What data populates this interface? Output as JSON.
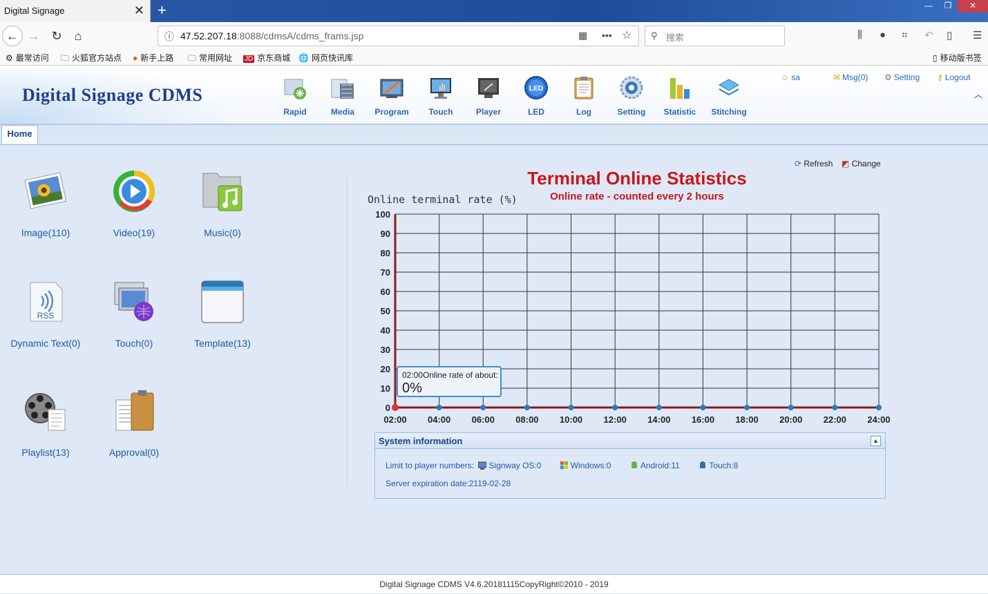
{
  "browser": {
    "tab_title": "Digital Signage",
    "url_host": "47.52.207.18",
    "url_rest": ":8088/cdmsA/cdms_frams.jsp",
    "search_placeholder": "搜索",
    "bookmarks": [
      "最常访问",
      "火狐官方站点",
      "新手上路",
      "常用网址",
      "京东商城",
      "网页快讯库"
    ],
    "mobile_bookmarks": "移动版书签"
  },
  "app": {
    "brand": "Digital Signage CDMS",
    "modules": [
      {
        "label": "Rapid",
        "icon": "rapid-icon",
        "color": "#5aa86b"
      },
      {
        "label": "Media",
        "icon": "media-icon",
        "color": "#7b8ea8"
      },
      {
        "label": "Program",
        "icon": "program-icon",
        "color": "#e07a2a"
      },
      {
        "label": "Touch",
        "icon": "touch-icon",
        "color": "#4a90d0"
      },
      {
        "label": "Player",
        "icon": "player-icon",
        "color": "#555"
      },
      {
        "label": "LED",
        "icon": "led-icon",
        "color": "#2a6fd0"
      },
      {
        "label": "Log",
        "icon": "log-icon",
        "color": "#c09040"
      },
      {
        "label": "Setting",
        "icon": "setting-icon",
        "color": "#3a7ac0"
      },
      {
        "label": "Statistic",
        "icon": "statistic-icon",
        "color": "#6ab04c"
      },
      {
        "label": "Stitching",
        "icon": "stitching-icon",
        "color": "#3a8ad8"
      }
    ],
    "user": "sa",
    "msg": "Msg(0)",
    "setting": "Setting",
    "logout": "Logout"
  },
  "tabs": {
    "home": "Home"
  },
  "shortcuts": [
    {
      "label": "Image(110)",
      "icon": "image-icon"
    },
    {
      "label": "Video(19)",
      "icon": "video-icon"
    },
    {
      "label": "Music(0)",
      "icon": "music-icon"
    },
    {
      "label": "Dynamic Text(0)",
      "icon": "rss-icon"
    },
    {
      "label": "Touch(0)",
      "icon": "touch-screen-icon"
    },
    {
      "label": "Template(13)",
      "icon": "template-icon"
    },
    {
      "label": "Playlist(13)",
      "icon": "playlist-icon"
    },
    {
      "label": "Approval(0)",
      "icon": "approval-icon"
    }
  ],
  "chart_links": {
    "refresh": "Refresh",
    "change": "Change"
  },
  "chart_data": {
    "type": "line",
    "title": "Terminal Online Statistics",
    "subtitle": "Online rate - counted every 2 hours",
    "ylabel": "Online terminal rate (%)",
    "xlabel": "",
    "categories": [
      "02:00",
      "04:00",
      "06:00",
      "08:00",
      "10:00",
      "12:00",
      "14:00",
      "16:00",
      "18:00",
      "20:00",
      "22:00",
      "24:00"
    ],
    "values": [
      0,
      0,
      0,
      0,
      0,
      0,
      0,
      0,
      0,
      0,
      0,
      0
    ],
    "ylim": [
      0,
      100
    ],
    "yticks": [
      0,
      10,
      20,
      30,
      40,
      50,
      60,
      70,
      80,
      90,
      100
    ],
    "grid": true,
    "tooltip": {
      "time": "02:00",
      "text": "Online rate of about:",
      "value": "0%"
    },
    "line_color": "#8b1a1a",
    "point_color": "#2a7ac0",
    "highlight_color": "#e03030"
  },
  "system_info": {
    "title": "System information",
    "limit_label": "Limit to player numbers:",
    "signway": "Signway OS:0",
    "windows": "Windows:0",
    "android": "Android:11",
    "touch": "Touch:8",
    "expiration": "Server expiration date:2119-02-28"
  },
  "footer": "Digital Signage CDMS V4.6.20181115CopyRight©2010 - 2019"
}
